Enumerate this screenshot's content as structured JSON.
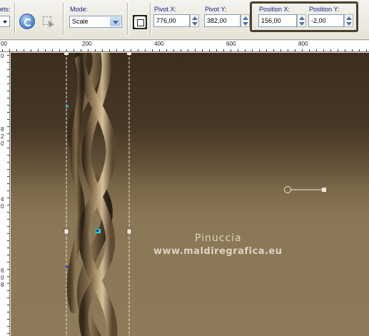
{
  "toolbar": {
    "presets_label_fragment": "ets:",
    "mode": {
      "label": "Mode:",
      "value": "Scale"
    },
    "pivot_x": {
      "label": "Pivot X:",
      "value": "776,00"
    },
    "pivot_y": {
      "label": "Pivot Y:",
      "value": "382,00"
    },
    "position_x": {
      "label": "Position X:",
      "value": "156,00"
    },
    "position_y": {
      "label": "Position Y:",
      "value": "-2,00"
    }
  },
  "ruler": {
    "horizontal_labels": [
      "00",
      "200",
      "400",
      "600",
      "800"
    ],
    "vertical_labels": [
      "0",
      "8",
      "2",
      "0",
      "4",
      "0",
      "6",
      "0",
      "8"
    ]
  },
  "watermark": {
    "line1": "Pinuccia",
    "line2": "www.maldiregrafica.eu"
  },
  "colors": {
    "canvas_dark": "#3c2e1f",
    "canvas_light": "#8d7a58",
    "highlight_border": "#4a3f2f",
    "label_text": "#1b1b8a"
  }
}
